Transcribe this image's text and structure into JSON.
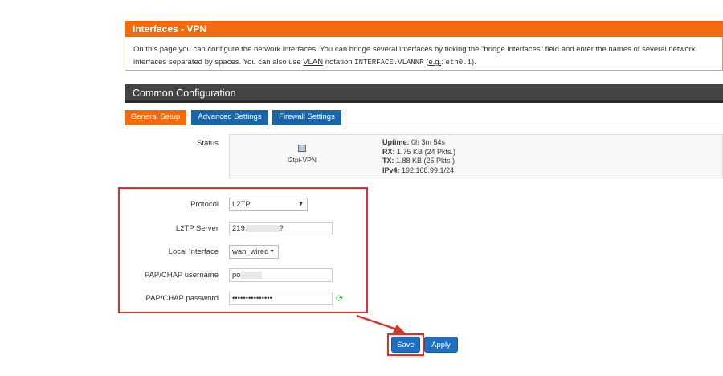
{
  "intro_panel": {
    "title": "Interfaces - VPN",
    "text_part1": "On this page you can configure the network interfaces. You can bridge several interfaces by ticking the \"bridge interfaces\" field and enter the names of several network interfaces separated by spaces. You can also use ",
    "vlan_word": "VLAN",
    "text_part2": " notation ",
    "notation_code": "INTERFACE.VLANNR",
    "text_part3": " (",
    "eg_word": "e.g.",
    "text_part4": ": ",
    "example_code": "eth0.1",
    "text_part5": ")."
  },
  "section": {
    "title": "Common Configuration"
  },
  "tabs": [
    {
      "label": "General Setup",
      "active": true
    },
    {
      "label": "Advanced Settings",
      "active": false
    },
    {
      "label": "Firewall Settings",
      "active": false
    }
  ],
  "status": {
    "label": "Status",
    "interface_name": "l2tpi-VPN",
    "uptime_label": "Uptime:",
    "uptime_value": " 0h 3m 54s",
    "rx_label": "RX:",
    "rx_value": " 1.75 KB (24 Pkts.)",
    "tx_label": "TX:",
    "tx_value": " 1.88 KB (25 Pkts.)",
    "ipv4_label": "IPv4:",
    "ipv4_value": " 192.168.99.1/24"
  },
  "form": {
    "protocol_label": "Protocol",
    "protocol_value": "L2TP",
    "server_label": "L2TP Server",
    "server_value_prefix": "219.",
    "server_value_suffix": "?",
    "local_iface_label": "Local Interface",
    "local_iface_value": "wan_wired",
    "username_label": "PAP/CHAP username",
    "username_value_prefix": "po",
    "password_label": "PAP/CHAP password",
    "password_value": "•••••••••••••••"
  },
  "buttons": {
    "save": "Save",
    "apply": "Apply"
  },
  "colors": {
    "accent_orange": "#f26b0f",
    "tab_blue": "#1a64a8",
    "highlight_red": "#e0302a"
  }
}
